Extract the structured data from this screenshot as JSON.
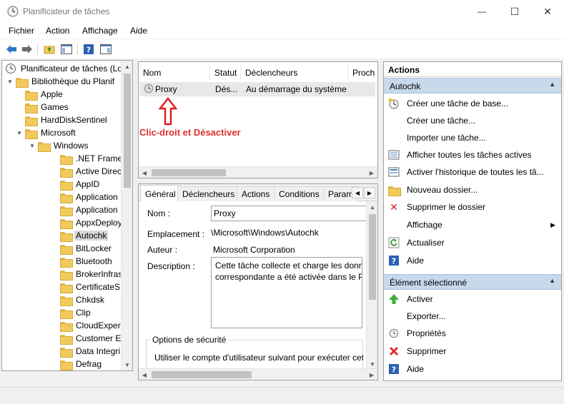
{
  "window": {
    "title": "Planificateur de tâches",
    "minimize_symbol": "—",
    "maximize_symbol": "☐",
    "close_symbol": "✕"
  },
  "menu": [
    "Fichier",
    "Action",
    "Affichage",
    "Aide"
  ],
  "tree": {
    "root": "Planificateur de tâches (Lo",
    "library": "Bibliothèque du Planif",
    "top_folders": [
      "Apple",
      "Games",
      "HardDiskSentinel"
    ],
    "microsoft": "Microsoft",
    "windows": "Windows",
    "windows_children": [
      ".NET Frame",
      "Active Direc",
      "AppID",
      "Application",
      "Application",
      "AppxDeploy",
      "Autochk",
      "BitLocker",
      "Bluetooth",
      "BrokerInfras",
      "CertificateS",
      "Chkdsk",
      "Clip",
      "CloudExper",
      "Customer E",
      "Data Integri",
      "Defrag"
    ],
    "selected": "Autochk"
  },
  "tasklist": {
    "columns": [
      "Nom",
      "Statut",
      "Déclencheurs",
      "Proch"
    ],
    "rows": [
      {
        "name": "Proxy",
        "status": "Dés...",
        "trigger": "Au démarrage du système"
      }
    ]
  },
  "annotation": "Clic-droit et Désactiver",
  "detail": {
    "tabs": [
      "Général",
      "Déclencheurs",
      "Actions",
      "Conditions",
      "Param"
    ],
    "active_tab": "Général",
    "labels": {
      "name": "Nom :",
      "location": "Emplacement :",
      "author": "Auteur :",
      "description": "Description :"
    },
    "values": {
      "name": "Proxy",
      "location": "\\Microsoft\\Windows\\Autochk",
      "author": "Microsoft Corporation",
      "description_line1": "Cette tâche collecte et charge les donn",
      "description_line2": "correspondante a été activée dans le Pr"
    },
    "security": {
      "title": "Options de sécurité",
      "text": "Utiliser le compte d'utilisateur suivant pour exécuter cet"
    }
  },
  "actions": {
    "header": "Actions",
    "section1": "Autochk",
    "section1_items": [
      {
        "label": "Créer une tâche de base...",
        "icon": "clock-star-icon"
      },
      {
        "label": "Créer une tâche...",
        "icon": "blank-icon"
      },
      {
        "label": "Importer une tâche...",
        "icon": "blank-icon"
      },
      {
        "label": "Afficher toutes les tâches actives",
        "icon": "list-view-icon"
      },
      {
        "label": "Activer l'historique de toutes les tâ...",
        "icon": "history-icon"
      },
      {
        "label": "Nouveau dossier...",
        "icon": "folder-icon"
      },
      {
        "label": "Supprimer le dossier",
        "icon": "delete-x-icon"
      },
      {
        "label": "Affichage",
        "icon": "blank-icon",
        "submenu": true
      },
      {
        "label": "Actualiser",
        "icon": "refresh-icon"
      },
      {
        "label": "Aide",
        "icon": "help-icon"
      }
    ],
    "section2": "Élément sélectionné",
    "section2_items": [
      {
        "label": "Activer",
        "icon": "green-up-arrow-icon"
      },
      {
        "label": "Exporter...",
        "icon": "blank-icon"
      },
      {
        "label": "Propriétés",
        "icon": "clock-icon"
      },
      {
        "label": "Supprimer",
        "icon": "red-x-icon"
      },
      {
        "label": "Aide",
        "icon": "help-icon"
      }
    ]
  },
  "colors": {
    "section_bg": "#c9d9ec",
    "annotation": "#e03030",
    "selected_row": "#e8e8e8"
  }
}
